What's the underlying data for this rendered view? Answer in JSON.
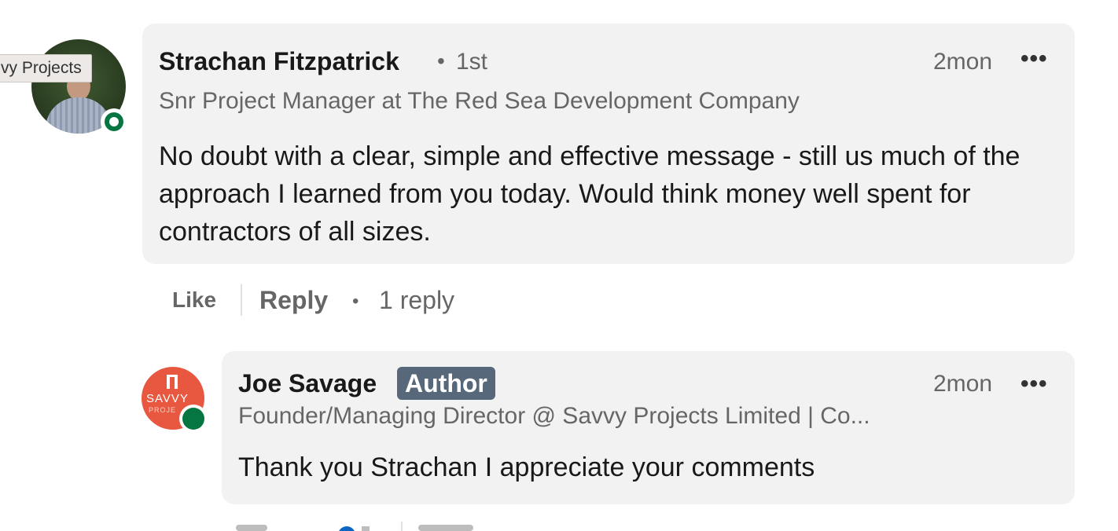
{
  "tooltip": {
    "text": "vy Projects"
  },
  "comment": {
    "author": "Strachan Fitzpatrick",
    "separator": "•",
    "degree": "1st",
    "time": "2mon",
    "more_label": "•••",
    "headline": "Snr Project Manager at The Red Sea Development Company",
    "text": "No doubt with a clear, simple and effective message - still us much of the approach I learned from you today. Would think money well spent for contractors of all sizes.",
    "actions": {
      "like_label": "Like",
      "reply_label": "Reply",
      "separator": "•",
      "reply_count": "1 reply"
    }
  },
  "reply": {
    "author": "Joe Savage",
    "badge": "Author",
    "time": "2mon",
    "more_label": "•••",
    "headline": "Founder/Managing Director @ Savvy Projects Limited | Co...",
    "text": "Thank you Strachan I appreciate your comments",
    "avatar_logo_text": "SAVVY",
    "avatar_logo_subtext": "PROJE"
  },
  "colors": {
    "bubble_bg": "#f2f2f2",
    "badge_bg": "#56687a",
    "presence_green": "#057642",
    "avatar2_bg": "#e8573f",
    "muted_text": "#666666"
  }
}
